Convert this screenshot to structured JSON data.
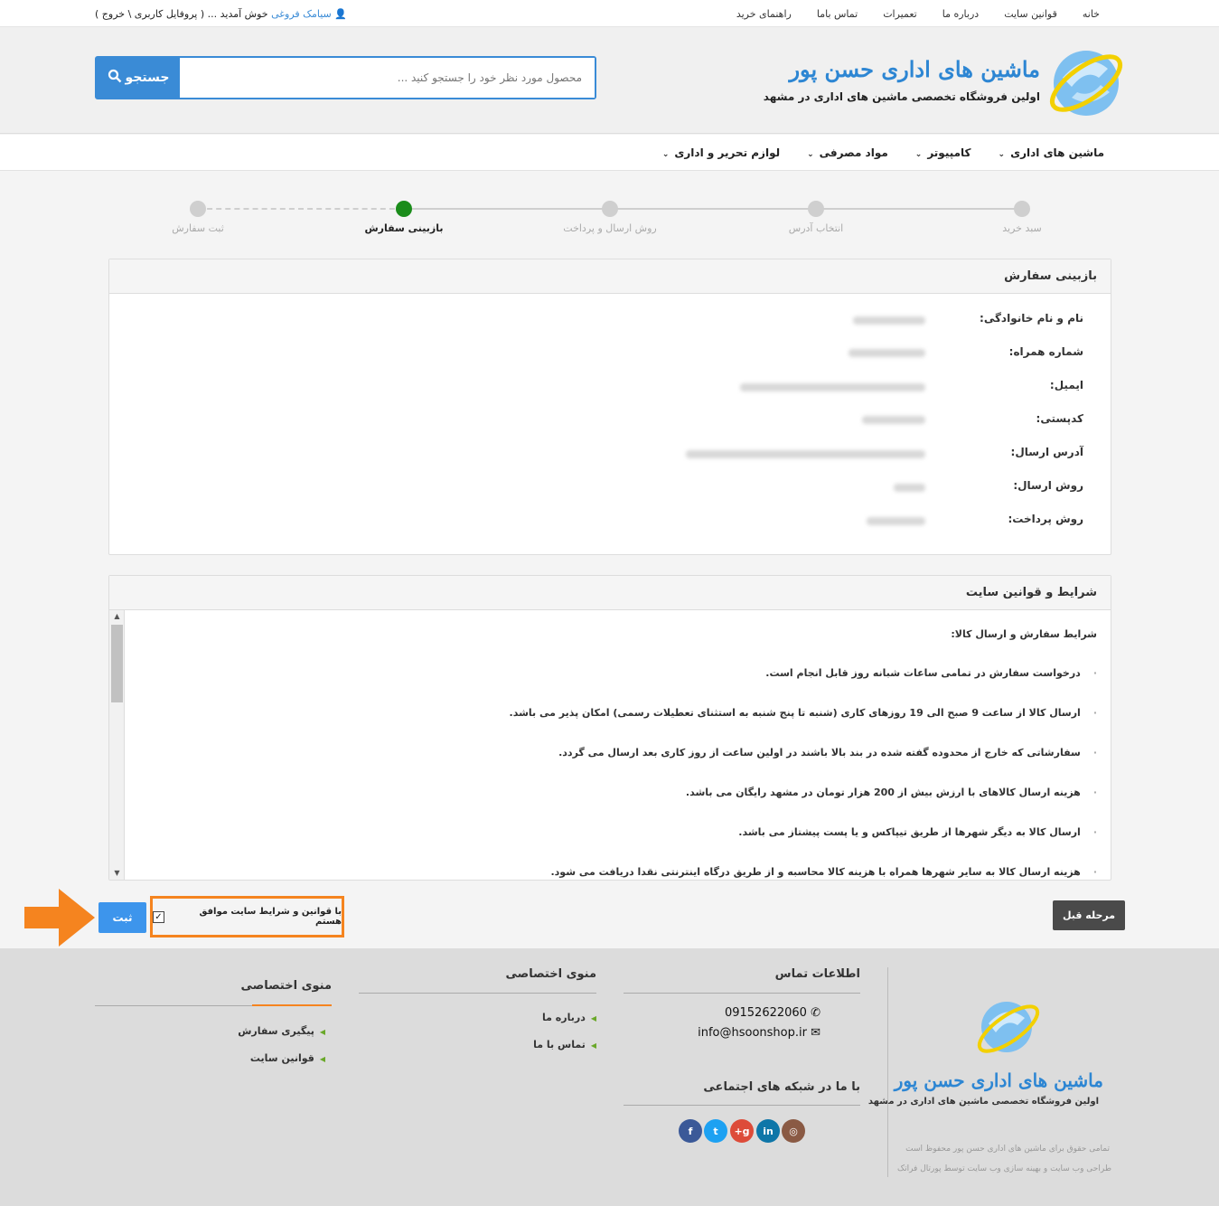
{
  "topbar": {
    "nav": [
      "خانه",
      "قوانین سایت",
      "درباره ما",
      "تعمیرات",
      "تماس باما",
      "راهنمای خرید"
    ],
    "welcome_user": "سیامک فروغی",
    "welcome_text": "خوش آمدید ... ( پروفایل کاربری \\ خروج )"
  },
  "header": {
    "brand_title": "ماشین های اداری حسن پور",
    "brand_subtitle": "اولین فروشگاه تخصصی ماشین های اداری در مشهد",
    "search_placeholder": "محصول مورد نظر خود را جستجو کنید ...",
    "search_button": "جستجو"
  },
  "menu": [
    "ماشین های اداری",
    "کامپیوتر",
    "مواد مصرفی",
    "لوازم تحریر و اداری"
  ],
  "steps": [
    {
      "label": "سبد خرید",
      "active": false
    },
    {
      "label": "انتخاب آدرس",
      "active": false
    },
    {
      "label": "روش ارسال و پرداخت",
      "active": false
    },
    {
      "label": "بازبینی سفارش",
      "active": true
    },
    {
      "label": "ثبت سفارش",
      "active": false
    }
  ],
  "review": {
    "title": "بازبینی سفارش",
    "fields": [
      "نام و نام خانوادگی:",
      "شماره همراه:",
      "ایمیل:",
      "کدپستی:",
      "آدرس ارسال:",
      "روش ارسال:",
      "روش پرداخت:"
    ]
  },
  "terms": {
    "title": "شرایط و قوانین سایت",
    "subtitle": "شرایط سفارش و ارسال کالا:",
    "items": [
      "درخواست سفارش در تمامی ساعات شبانه روز قابل انجام است.",
      "ارسال کالا از ساعت 9 صبح الی 19 روزهای کاری (شنبه تا پنج شنبه به استثنای تعطیلات رسمی) امکان پذیر می باشد.",
      "سفارشاتی که خارج از محدوده گفته شده در بند بالا باشند در اولین ساعت از روز کاری بعد ارسال می گردد.",
      "هزینه ارسال کالاهای با ارزش بیش از 200 هزار تومان در مشهد رایگان می باشد.",
      "ارسال کالا به دیگر شهرها از طریق تیپاکس و یا پست پیشتاز می باشد.",
      "هزینه ارسال کالا به سایر شهرها همراه با هزینه کالا محاسبه و از طریق درگاه اینترنتی نقدا دریافت می شود."
    ]
  },
  "actions": {
    "prev": "مرحله قبل",
    "agree": "با قوانین و شرایط سایت موافق هستم",
    "submit": "ثبت"
  },
  "footer": {
    "brand_title": "ماشین های اداری حسن پور",
    "brand_subtitle": "اولین فروشگاه تخصصی ماشین های اداری در مشهد",
    "contact_title": "اطلاعات تماس",
    "phone": "09152622060",
    "email": "info@hsoonshop.ir",
    "social_title": "با ما در شبکه های اجتماعی",
    "menu1_title": "منوی اختصاصی",
    "menu1_items": [
      "درباره ما",
      "تماس با ما"
    ],
    "menu2_title": "منوی اختصاصی",
    "menu2_items": [
      "پیگیری سفارش",
      "قوانین سایت"
    ],
    "copyright": "تمامی حقوق برای ماشین های اداری حسن پور محفوظ است",
    "designer": "طراحی وب سایت و بهینه سازی وب سایت توسط پورتال فراتک"
  },
  "colors": {
    "accent": "#3a8bd6",
    "active_step": "#1a8c1a",
    "highlight": "#f5841f",
    "dark_button": "#4a4a4a"
  }
}
